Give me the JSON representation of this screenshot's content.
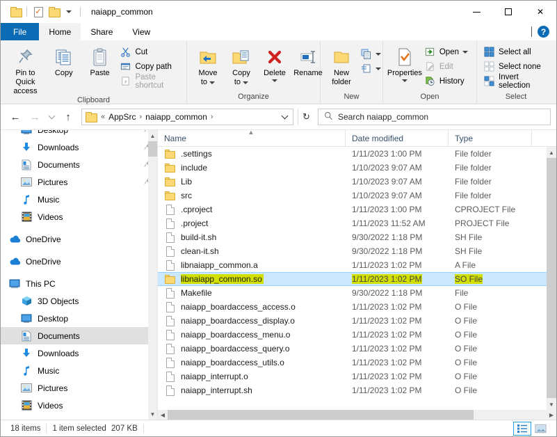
{
  "window": {
    "title": "naiapp_common",
    "quick_access": [
      {
        "name": "folder-icon",
        "label": "Folder"
      },
      {
        "name": "properties-icon",
        "label": "Properties"
      },
      {
        "name": "new-folder-icon",
        "label": "New folder"
      },
      {
        "name": "customize-caret-icon",
        "label": "Customize Quick Access Toolbar"
      }
    ],
    "controls": {
      "minimize": "Minimize",
      "maximize": "Maximize",
      "close": "Close"
    }
  },
  "tabs": [
    {
      "label": "File",
      "id": "file"
    },
    {
      "label": "Home",
      "id": "home"
    },
    {
      "label": "Share",
      "id": "share"
    },
    {
      "label": "View",
      "id": "view"
    }
  ],
  "tab_right": {
    "collapse": "Collapse the Ribbon",
    "help": "?"
  },
  "ribbon": {
    "groups": [
      {
        "label": "Clipboard",
        "big": [
          {
            "label1": "Pin to Quick",
            "label2": "access",
            "icon": "pin-icon"
          },
          {
            "label1": "Copy",
            "label2": "",
            "icon": "copy-icon"
          },
          {
            "label1": "Paste",
            "label2": "",
            "icon": "paste-icon"
          }
        ],
        "small": [
          {
            "label": "Cut",
            "icon": "scissors-icon",
            "disabled": false
          },
          {
            "label": "Copy path",
            "icon": "copy-path-icon",
            "disabled": false
          },
          {
            "label": "Paste shortcut",
            "icon": "paste-shortcut-icon",
            "disabled": true
          }
        ]
      },
      {
        "label": "Organize",
        "big": [
          {
            "label1": "Move",
            "label2": "to",
            "icon": "move-to-icon",
            "caret": true
          },
          {
            "label1": "Copy",
            "label2": "to",
            "icon": "copy-to-icon",
            "caret": true
          },
          {
            "label1": "Delete",
            "label2": "",
            "icon": "delete-icon",
            "caret": true
          },
          {
            "label1": "Rename",
            "label2": "",
            "icon": "rename-icon",
            "caret": false
          }
        ],
        "small": []
      },
      {
        "label": "New",
        "big": [
          {
            "label1": "New",
            "label2": "folder",
            "icon": "new-folder-icon",
            "caret": false
          }
        ],
        "small": [
          {
            "label": "",
            "icon": "new-item-icon",
            "disabled": false
          },
          {
            "label": "",
            "icon": "easy-access-icon",
            "disabled": false
          }
        ]
      },
      {
        "label": "Open",
        "big": [
          {
            "label1": "Properties",
            "label2": "",
            "icon": "properties-icon",
            "caret": true
          }
        ],
        "small": [
          {
            "label": "Open",
            "icon": "open-icon",
            "disabled": false,
            "caret": true
          },
          {
            "label": "Edit",
            "icon": "edit-icon",
            "disabled": true
          },
          {
            "label": "History",
            "icon": "history-icon",
            "disabled": false
          }
        ]
      },
      {
        "label": "Select",
        "big": [],
        "small": [
          {
            "label": "Select all",
            "icon": "select-all-icon",
            "disabled": false
          },
          {
            "label": "Select none",
            "icon": "select-none-icon",
            "disabled": false
          },
          {
            "label": "Invert selection",
            "icon": "invert-selection-icon",
            "disabled": false
          }
        ]
      }
    ]
  },
  "address": {
    "back": "Back",
    "forward": "Forward",
    "recent": "Recent locations",
    "up": "Up",
    "breadcrumbs": [
      "AppSrc",
      "naiapp_common"
    ],
    "overflow": "«",
    "refresh": "Refresh"
  },
  "search": {
    "placeholder": "Search naiapp_common",
    "icon": "search-icon"
  },
  "nav": {
    "items": [
      {
        "label": "Desktop",
        "icon": "desktop-icon",
        "level": 1,
        "pinned": true,
        "selected": false
      },
      {
        "label": "Downloads",
        "icon": "downloads-icon",
        "level": 1,
        "pinned": true,
        "selected": false
      },
      {
        "label": "Documents",
        "icon": "documents-icon",
        "level": 1,
        "pinned": true,
        "selected": false
      },
      {
        "label": "Pictures",
        "icon": "pictures-icon",
        "level": 1,
        "pinned": true,
        "selected": false
      },
      {
        "label": "Music",
        "icon": "music-icon",
        "level": 1,
        "pinned": false,
        "selected": false
      },
      {
        "label": "Videos",
        "icon": "videos-icon",
        "level": 1,
        "pinned": false,
        "selected": false
      },
      {
        "label": "",
        "icon": "spacer",
        "level": 0,
        "spacer": true
      },
      {
        "label": "OneDrive",
        "icon": "onedrive-icon",
        "level": 0,
        "pinned": false,
        "selected": false
      },
      {
        "label": "",
        "icon": "spacer",
        "level": 0,
        "spacer": true
      },
      {
        "label": "OneDrive",
        "icon": "onedrive-icon",
        "level": 0,
        "pinned": false,
        "selected": false
      },
      {
        "label": "",
        "icon": "spacer",
        "level": 0,
        "spacer": true
      },
      {
        "label": "This PC",
        "icon": "thispc-icon",
        "level": 0,
        "pinned": false,
        "selected": false
      },
      {
        "label": "3D Objects",
        "icon": "3dobjects-icon",
        "level": 1,
        "pinned": false,
        "selected": false
      },
      {
        "label": "Desktop",
        "icon": "desktop-icon",
        "level": 1,
        "pinned": false,
        "selected": false
      },
      {
        "label": "Documents",
        "icon": "documents-icon",
        "level": 1,
        "pinned": false,
        "selected": true
      },
      {
        "label": "Downloads",
        "icon": "downloads-icon",
        "level": 1,
        "pinned": false,
        "selected": false
      },
      {
        "label": "Music",
        "icon": "music-icon",
        "level": 1,
        "pinned": false,
        "selected": false
      },
      {
        "label": "Pictures",
        "icon": "pictures-icon",
        "level": 1,
        "pinned": false,
        "selected": false
      },
      {
        "label": "Videos",
        "icon": "videos-icon",
        "level": 1,
        "pinned": false,
        "selected": false
      }
    ]
  },
  "filelist": {
    "columns": [
      {
        "label": "Name",
        "key": "name",
        "sorted": "asc"
      },
      {
        "label": "Date modified",
        "key": "date",
        "sorted": ""
      },
      {
        "label": "Type",
        "key": "type",
        "sorted": ""
      }
    ],
    "rows": [
      {
        "name": ".settings",
        "date": "1/11/2023 1:00 PM",
        "type": "File folder",
        "icon": "folder-icon",
        "selected": false,
        "highlighted": false
      },
      {
        "name": "include",
        "date": "1/10/2023 9:07 AM",
        "type": "File folder",
        "icon": "folder-icon",
        "selected": false,
        "highlighted": false
      },
      {
        "name": "Lib",
        "date": "1/10/2023 9:07 AM",
        "type": "File folder",
        "icon": "folder-icon",
        "selected": false,
        "highlighted": false
      },
      {
        "name": "src",
        "date": "1/10/2023 9:07 AM",
        "type": "File folder",
        "icon": "folder-icon",
        "selected": false,
        "highlighted": false
      },
      {
        "name": ".cproject",
        "date": "1/11/2023 1:00 PM",
        "type": "CPROJECT File",
        "icon": "file-icon",
        "selected": false,
        "highlighted": false
      },
      {
        "name": ".project",
        "date": "1/11/2023 11:52 AM",
        "type": "PROJECT File",
        "icon": "file-icon",
        "selected": false,
        "highlighted": false
      },
      {
        "name": "build-it.sh",
        "date": "9/30/2022 1:18 PM",
        "type": "SH File",
        "icon": "file-icon",
        "selected": false,
        "highlighted": false
      },
      {
        "name": "clean-it.sh",
        "date": "9/30/2022 1:18 PM",
        "type": "SH File",
        "icon": "file-icon",
        "selected": false,
        "highlighted": false
      },
      {
        "name": "libnaiapp_common.a",
        "date": "1/11/2023 1:02 PM",
        "type": "A File",
        "icon": "file-icon",
        "selected": false,
        "highlighted": false
      },
      {
        "name": "libnaiapp_common.so",
        "date": "1/11/2023 1:02 PM",
        "type": "SO File",
        "icon": "folder-icon",
        "selected": true,
        "highlighted": true
      },
      {
        "name": "Makefile",
        "date": "9/30/2022 1:18 PM",
        "type": "File",
        "icon": "file-icon",
        "selected": false,
        "highlighted": false
      },
      {
        "name": "naiapp_boardaccess_access.o",
        "date": "1/11/2023 1:02 PM",
        "type": "O File",
        "icon": "file-icon",
        "selected": false,
        "highlighted": false
      },
      {
        "name": "naiapp_boardaccess_display.o",
        "date": "1/11/2023 1:02 PM",
        "type": "O File",
        "icon": "file-icon",
        "selected": false,
        "highlighted": false
      },
      {
        "name": "naiapp_boardaccess_menu.o",
        "date": "1/11/2023 1:02 PM",
        "type": "O File",
        "icon": "file-icon",
        "selected": false,
        "highlighted": false
      },
      {
        "name": "naiapp_boardaccess_query.o",
        "date": "1/11/2023 1:02 PM",
        "type": "O File",
        "icon": "file-icon",
        "selected": false,
        "highlighted": false
      },
      {
        "name": "naiapp_boardaccess_utils.o",
        "date": "1/11/2023 1:02 PM",
        "type": "O File",
        "icon": "file-icon",
        "selected": false,
        "highlighted": false
      },
      {
        "name": "naiapp_interrupt.o",
        "date": "1/11/2023 1:02 PM",
        "type": "O File",
        "icon": "file-icon",
        "selected": false,
        "highlighted": false
      },
      {
        "name": "naiapp_interrupt.sh",
        "date": "1/11/2023 1:02 PM",
        "type": "O File",
        "icon": "file-icon",
        "selected": false,
        "highlighted": false
      }
    ]
  },
  "status": {
    "items_count": "18 items",
    "selection": "1 item selected",
    "size": "207 KB",
    "views": [
      {
        "name": "details-view-button",
        "active": true
      },
      {
        "name": "large-icons-view-button",
        "active": false
      }
    ]
  },
  "colors": {
    "accent": "#0b6cb5",
    "selection": "#cce8ff",
    "highlight": "#d2e000",
    "folder": "#fcd975"
  }
}
